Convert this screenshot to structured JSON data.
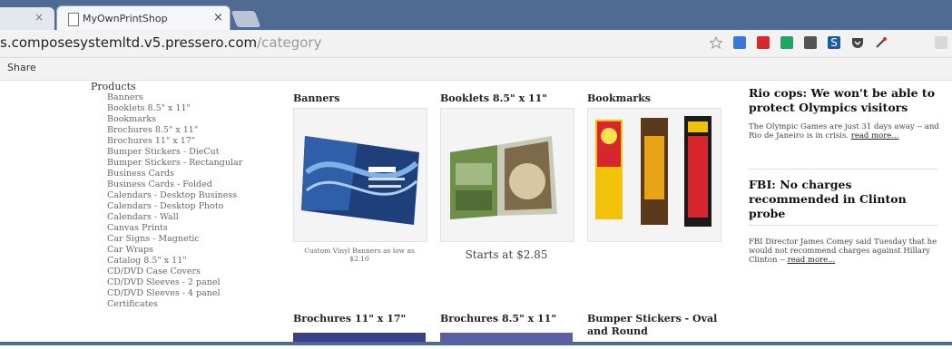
{
  "browser": {
    "active_tab_title": "MyOwnPrintShop",
    "tab_close_symbol": "×",
    "url_host": "s.composesystemltd.v5.pressero.com",
    "url_path": "/category",
    "bookmark_label": "Share",
    "extensions": [
      "star-icon",
      "translate-icon",
      "bookmark-red-icon",
      "sheets-icon",
      "puzzle-icon",
      "s-icon",
      "pocket-icon",
      "eyedropper-icon",
      "extension-icon"
    ]
  },
  "nav": {
    "heading": "Products",
    "items": [
      "Banners",
      "Booklets 8.5\" x 11\"",
      "Bookmarks",
      "Brochures 8.5\" x 11\"",
      "Brochures 11\" x 17\"",
      "Bumper Stickers - DieCut",
      "Bumper Stickers - Rectangular",
      "Business Cards",
      "Business Cards - Folded",
      "Calendars - Desktop Business",
      "Calendars - Desktop Photo",
      "Calendars - Wall",
      "Canvas Prints",
      "Car Signs - Magnetic",
      "Car Wraps",
      "Catalog 8.5\" x 11\"",
      "CD/DVD Case Covers",
      "CD/DVD Sleeves - 2 panel",
      "CD/DVD Sleeves - 4 panel",
      "Certificates"
    ]
  },
  "products": {
    "banners": {
      "title": "Banners",
      "caption": "Custom Vinyl Banners as low as $2.10"
    },
    "booklets": {
      "title": "Booklets 8.5\" x 11\"",
      "price": "Starts at $2.85"
    },
    "bookmarks": {
      "title": "Bookmarks"
    },
    "brochures_11x17": {
      "title": "Brochures 11\" x 17\""
    },
    "brochures_8x11": {
      "title": "Brochures 8.5\" x 11\""
    },
    "bumper_oval": {
      "title": "Bumper Stickers - Oval and Round"
    }
  },
  "news": [
    {
      "headline": "Rio cops: We won't be able to protect Olympics visitors",
      "summary": "The Olympic Games are just 31 days away -- and Rio de Janeiro is in crisis.",
      "read_more": "read more..."
    },
    {
      "headline": "FBI: No charges recommended in Clinton probe",
      "summary": "FBI Director James Comey said Tuesday that he would not recommend charges against Hillary Clinton --",
      "read_more": "read more..."
    }
  ],
  "colors": {
    "chrome_blue": "#4f6b94",
    "bookmark_red": "#d7262d",
    "bookmark_yellow": "#f2c20a"
  }
}
